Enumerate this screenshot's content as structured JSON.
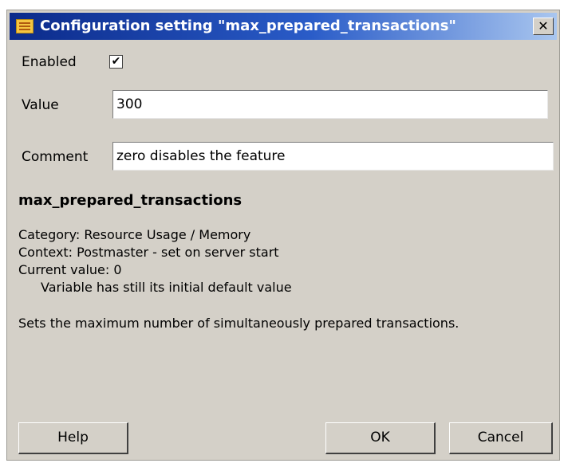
{
  "window": {
    "title": "Configuration setting \"max_prepared_transactions\"",
    "close_glyph": "✕"
  },
  "form": {
    "enabled_label": "Enabled",
    "enabled_checked": true,
    "check_glyph": "✔",
    "value_label": "Value",
    "value": "300",
    "comment_label": "Comment",
    "comment": "zero disables the feature"
  },
  "details": {
    "name": "max_prepared_transactions",
    "category": "Category: Resource Usage / Memory",
    "context": "Context: Postmaster - set on server start",
    "current_value": "Current value: 0",
    "default_note": "Variable has still its initial default value",
    "description": "Sets the maximum number of simultaneously prepared transactions."
  },
  "buttons": {
    "help": "Help",
    "ok": "OK",
    "cancel": "Cancel"
  },
  "icons": {
    "title_icon": "settings-list-icon",
    "close_icon": "close-icon"
  }
}
